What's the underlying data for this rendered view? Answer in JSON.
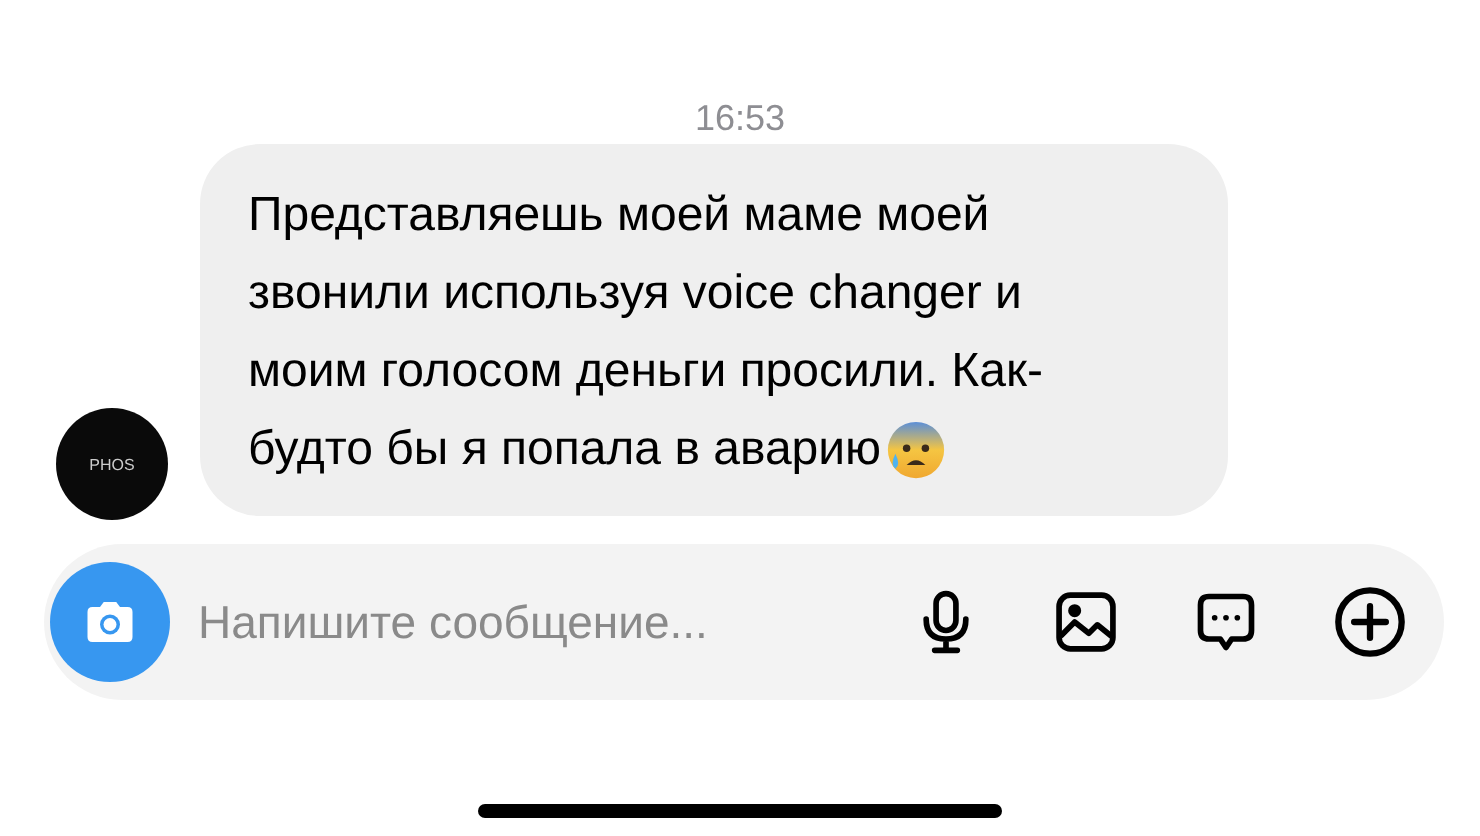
{
  "timestamp": "16:53",
  "message": {
    "lines": [
      "Представляешь моей маме моей",
      "звонили используя voice changer и",
      "моим голосом деньги просили. Как-",
      "будто бы я попала в аварию"
    ],
    "avatar_text": "PHOS"
  },
  "composer": {
    "placeholder": "Напишите сообщение...",
    "actions": [
      {
        "kind": "mic"
      },
      {
        "kind": "gallery"
      },
      {
        "kind": "sticker"
      },
      {
        "kind": "plus"
      }
    ]
  }
}
